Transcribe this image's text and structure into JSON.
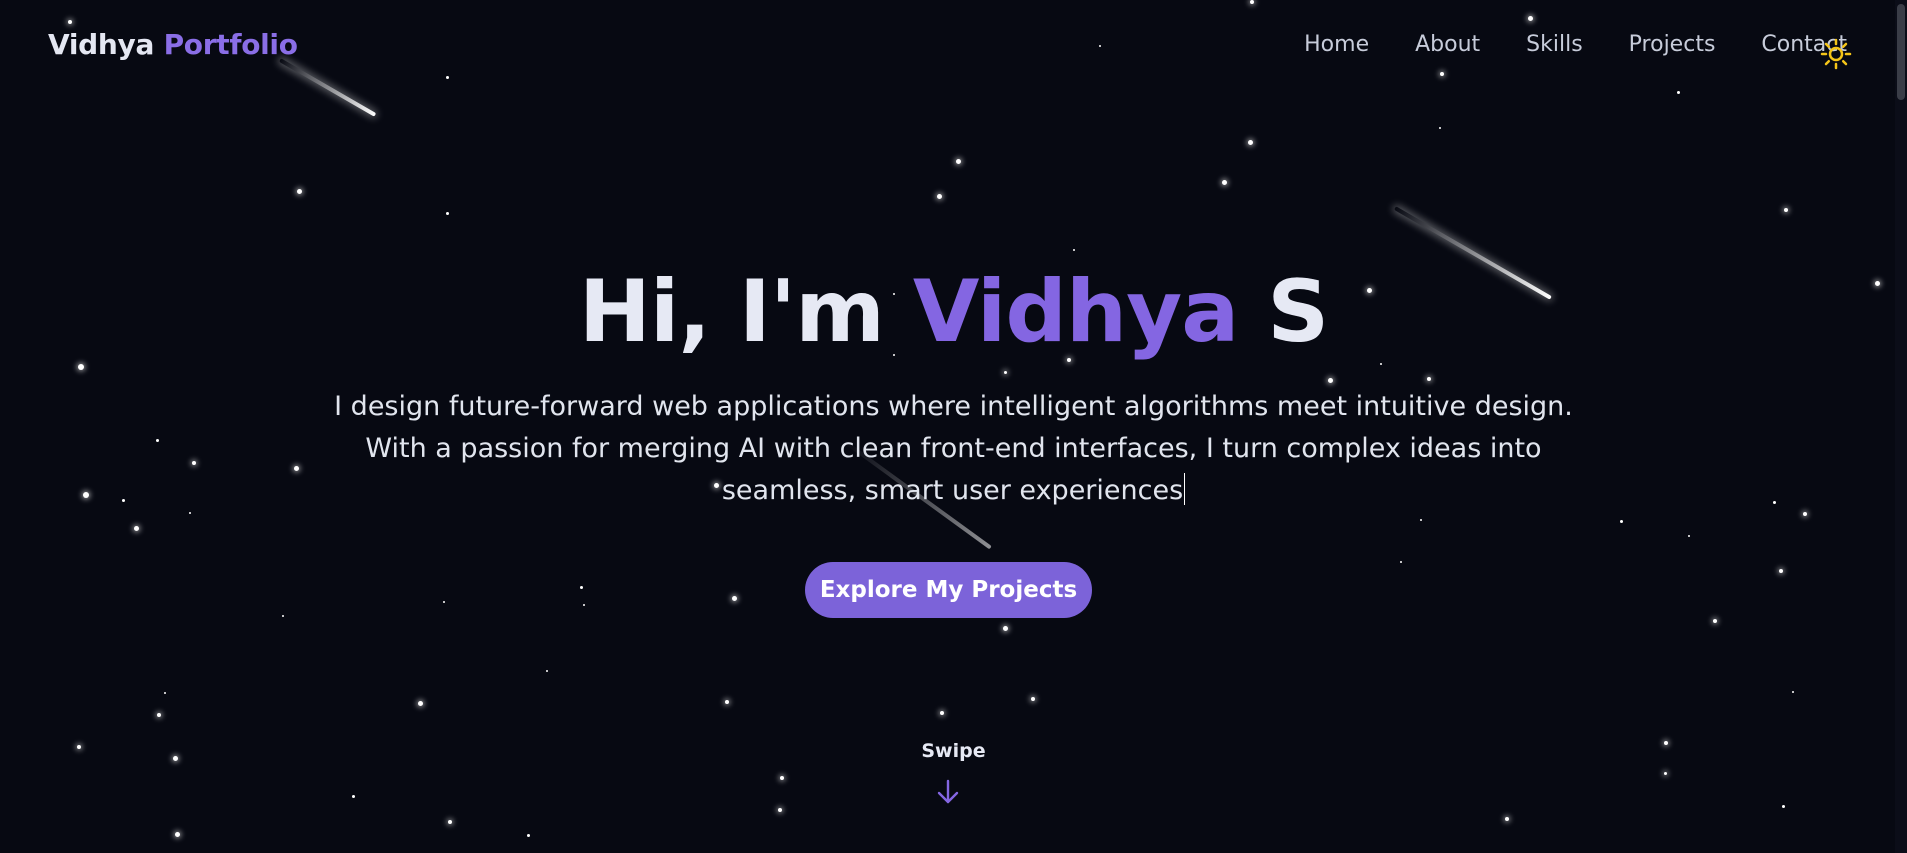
{
  "logo": {
    "first": "Vidhya",
    "second": "Portfolio"
  },
  "nav": {
    "items": [
      "Home",
      "About",
      "Skills",
      "Projects",
      "Contact"
    ],
    "theme_toggle_icon": "sun-icon"
  },
  "hero": {
    "greeting": "Hi, I'm",
    "name": "Vidhya",
    "surname": "S",
    "description": "I design future-forward web applications where intelligent algorithms meet intuitive design. With a passion for merging AI with clean front-end interfaces, I turn complex ideas into seamless, smart user experiences",
    "cta_label": "Explore My Projects"
  },
  "scroll_hint": {
    "label": "Swipe",
    "icon": "arrow-down-icon"
  },
  "colors": {
    "background": "#070912",
    "accent": "#8466e2",
    "button": "#7c63d9",
    "text": "#e6e9f4",
    "sun": "#f5c518"
  }
}
